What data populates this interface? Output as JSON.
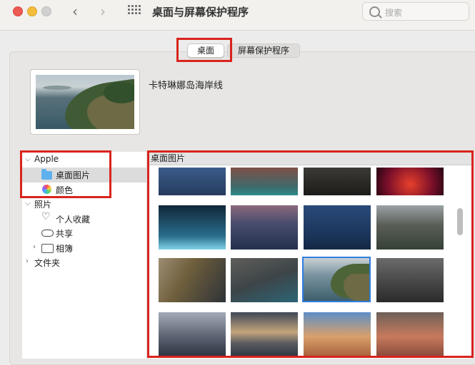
{
  "window": {
    "title": "桌面与屏幕保护程序"
  },
  "search": {
    "placeholder": "搜索"
  },
  "tabs": [
    {
      "label": "桌面",
      "active": true
    },
    {
      "label": "屏幕保护程序",
      "active": false
    }
  ],
  "current_wallpaper": {
    "name": "卡特琳娜岛海岸线"
  },
  "sidebar": {
    "apple_group": "Apple",
    "apple_items": [
      {
        "label": "桌面图片",
        "icon": "folder-icon",
        "selected": true
      },
      {
        "label": "颜色",
        "icon": "color-wheel-icon",
        "selected": false
      }
    ],
    "photos_group": "照片",
    "photos_items": [
      {
        "label": "个人收藏",
        "icon": "heart-icon"
      },
      {
        "label": "共享",
        "icon": "cloud-icon"
      },
      {
        "label": "相簿",
        "icon": "folder-icon"
      }
    ],
    "folders_group": "文件夹"
  },
  "gallery": {
    "header": "桌面图片",
    "selected_index": 10
  },
  "colors": {
    "highlight_box": "#d9241d",
    "selection_blue": "#2f7de1",
    "folder_blue": "#5eb1ec"
  }
}
